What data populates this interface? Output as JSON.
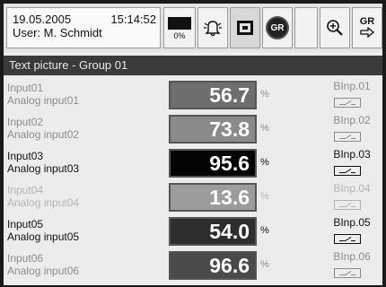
{
  "header": {
    "date": "19.05.2005",
    "time": "15:14:52",
    "user": "User: M. Schmidt",
    "storage_pct": "0%",
    "gr_label": "GR"
  },
  "title": "Text picture - Group 01",
  "channels": [
    {
      "name": "Input01",
      "desc": "Analog input01",
      "value": "56.7",
      "unit": "%",
      "binp": "BInp.01",
      "state": "dim",
      "fill": "#6e6e6e"
    },
    {
      "name": "Input02",
      "desc": "Analog input02",
      "value": "73.8",
      "unit": "%",
      "binp": "BInp.02",
      "state": "dim",
      "fill": "#8a8a8a"
    },
    {
      "name": "Input03",
      "desc": "Analog input03",
      "value": "95.6",
      "unit": "%",
      "binp": "BInp.03",
      "state": "active",
      "fill": "#050505"
    },
    {
      "name": "Input04",
      "desc": "Analog input04",
      "value": "13.6",
      "unit": "%",
      "binp": "BInp.04",
      "state": "vdim",
      "fill": "#9c9c9c"
    },
    {
      "name": "Input05",
      "desc": "Analog input05",
      "value": "54.0",
      "unit": "%",
      "binp": "BInp.05",
      "state": "active",
      "fill": "#2e2e2e"
    },
    {
      "name": "Input06",
      "desc": "Analog input06",
      "value": "96.6",
      "unit": "%",
      "binp": "BInp.06",
      "state": "dim",
      "fill": "#4a4a4a"
    }
  ]
}
